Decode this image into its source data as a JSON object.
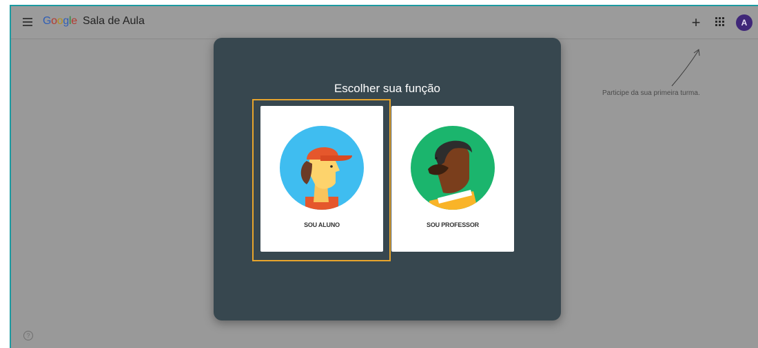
{
  "app": {
    "logo": [
      "G",
      "o",
      "o",
      "g",
      "l",
      "e"
    ],
    "product_name": "Sala de Aula",
    "avatar_letter": "A",
    "plus_glyph": "+"
  },
  "hint": {
    "text": "Participe da sua primeira turma."
  },
  "help": {
    "glyph": "?"
  },
  "dialog": {
    "title": "Escolher sua função",
    "cards": [
      {
        "label": "SOU ALUNO",
        "selected": true
      },
      {
        "label": "SOU PROFESSOR",
        "selected": false
      }
    ]
  },
  "icons": {
    "menu": "menu-icon",
    "add": "plus-icon",
    "apps": "apps-grid-icon",
    "help": "help-icon"
  },
  "colors": {
    "frame": "#1b9aa1",
    "dialog_bg": "#37474f",
    "highlight": "#e8a52c",
    "avatar_bg": "#3f2778",
    "student_circle": "#3fbdf0",
    "teacher_circle": "#1bb56d"
  }
}
